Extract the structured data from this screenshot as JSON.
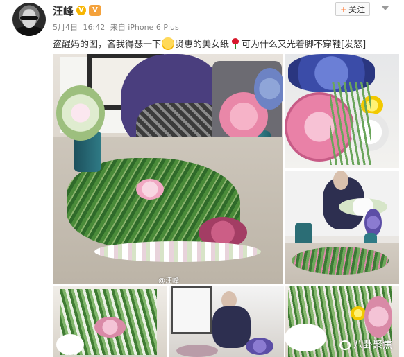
{
  "user": {
    "name": "汪峰",
    "verified_badge": "V",
    "level_badge": "V"
  },
  "post": {
    "date": "5月4日",
    "time": "16:42",
    "source": "来自 iPhone 6 Plus",
    "text_part1": "盗醒妈的图，吝我得瑟一下",
    "text_part2": "贤惠的美女纸",
    "text_part3": "可为什么又光着脚不穿鞋[发怒]"
  },
  "follow": {
    "label": "关注",
    "plus": "+"
  },
  "photos": {
    "watermark_main": "@汪峰",
    "watermark_bottom": "八卦聚焦"
  },
  "icons": {
    "avatar": "avatar-icon",
    "emoji_smile": "smile-emoji-icon",
    "emoji_rose": "rose-emoji-icon",
    "chevron": "chevron-down-icon"
  },
  "colors": {
    "accent_orange": "#ff8140",
    "badge_gold": "#f7b500",
    "badge_orange": "#f4a23c",
    "text_gray": "#808080"
  }
}
